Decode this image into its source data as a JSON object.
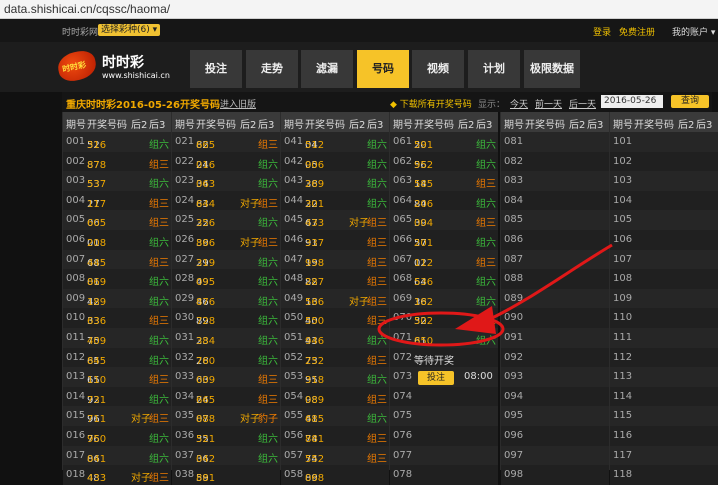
{
  "browser": {
    "url": "data.shishicai.cn/cqssc/haoma/"
  },
  "topbar": {
    "site": "时时彩网",
    "lottery_select": "选择彩种(6) ▾",
    "login": "登录",
    "register": "免费注册",
    "account": "我的账户 ▾"
  },
  "nav": {
    "logo_badge": "时时彩",
    "logo_cn": "时时彩",
    "logo_en": "www.shishicai.cn",
    "tabs": [
      "投注",
      "走势",
      "滤漏",
      "号码",
      "视频",
      "计划",
      "极限数据"
    ],
    "active_tab": "号码"
  },
  "datebar": {
    "title": "重庆时时彩2016-05-26开奖号码",
    "old_version": "进入旧版",
    "download": "◆ 下载所有开奖号码",
    "show_label": "显示：",
    "today": "今天",
    "prev_day": "前一天",
    "next_day": "后一天",
    "date_value": "2016-05-26",
    "query": "查询"
  },
  "table": {
    "headers": [
      "期号",
      "开奖号码",
      "后2",
      "后3"
    ],
    "columns": [
      [
        [
          "001",
          "52",
          "316",
          "",
          "组六"
        ],
        [
          "002",
          "87",
          "878",
          "",
          "组三"
        ],
        [
          "003",
          "53",
          "537",
          "",
          "组六"
        ],
        [
          "004",
          "27",
          "117",
          "",
          "组三"
        ],
        [
          "005",
          "06",
          "605",
          "",
          "组三"
        ],
        [
          "006",
          "01",
          "208",
          "",
          "组六"
        ],
        [
          "007",
          "68",
          "445",
          "",
          "组三"
        ],
        [
          "008",
          "01",
          "869",
          "",
          "组六"
        ],
        [
          "009",
          "42",
          "189",
          "",
          "组六"
        ],
        [
          "010",
          "33",
          "636",
          "",
          "组三"
        ],
        [
          "011",
          "75",
          "409",
          "",
          "组六"
        ],
        [
          "012",
          "65",
          "845",
          "",
          "组六"
        ],
        [
          "013",
          "65",
          "110",
          "",
          "组三"
        ],
        [
          "014",
          "92",
          "731",
          "",
          "组六"
        ],
        [
          "015",
          "96",
          "711",
          "对子",
          "组三"
        ],
        [
          "016",
          "76",
          "950",
          "",
          "组六"
        ],
        [
          "017",
          "86",
          "041",
          "",
          "组六"
        ],
        [
          "018",
          "48",
          "433",
          "对子",
          "组三"
        ]
      ],
      [
        [
          "021",
          "82",
          "665",
          "",
          "组三"
        ],
        [
          "022",
          "24",
          "016",
          "",
          "组六"
        ],
        [
          "023",
          "34",
          "063",
          "",
          "组六"
        ],
        [
          "024",
          "83",
          "644",
          "对子",
          "组三"
        ],
        [
          "025",
          "22",
          "356",
          "",
          "组六"
        ],
        [
          "026",
          "39",
          "866",
          "对子",
          "组三"
        ],
        [
          "027",
          "29",
          "319",
          "",
          "组六"
        ],
        [
          "028",
          "49",
          "095",
          "",
          "组六"
        ],
        [
          "029",
          "46",
          "876",
          "",
          "组六"
        ],
        [
          "030",
          "89",
          "728",
          "",
          "组六"
        ],
        [
          "031",
          "23",
          "384",
          "",
          "组六"
        ],
        [
          "032",
          "28",
          "760",
          "",
          "组六"
        ],
        [
          "033",
          "63",
          "009",
          "",
          "组三"
        ],
        [
          "034",
          "24",
          "665",
          "",
          "组三"
        ],
        [
          "035",
          "07",
          "888",
          "对子",
          "豹子"
        ],
        [
          "036",
          "35",
          "521",
          "",
          "组六"
        ],
        [
          "037",
          "36",
          "042",
          "",
          "组六"
        ],
        [
          "038",
          "59",
          "881",
          "",
          ""
        ]
      ],
      [
        [
          "041",
          "04",
          "512",
          "",
          "组六"
        ],
        [
          "042",
          "05",
          "906",
          "",
          "组六"
        ],
        [
          "043",
          "38",
          "269",
          "",
          "组六"
        ],
        [
          "044",
          "22",
          "301",
          "",
          "组六"
        ],
        [
          "045",
          "67",
          "433",
          "对子",
          "组三"
        ],
        [
          "046",
          "91",
          "337",
          "",
          "组三"
        ],
        [
          "047",
          "19",
          "958",
          "",
          "组三"
        ],
        [
          "048",
          "82",
          "287",
          "",
          "组三"
        ],
        [
          "049",
          "13",
          "566",
          "对子",
          "组三"
        ],
        [
          "050",
          "40",
          "550",
          "",
          "组三"
        ],
        [
          "051",
          "43",
          "946",
          "",
          "组六"
        ],
        [
          "052",
          "73",
          "252",
          "",
          "组三"
        ],
        [
          "053",
          "95",
          "318",
          "",
          "组六"
        ],
        [
          "054",
          "98",
          "089",
          "",
          "组三"
        ],
        [
          "055",
          "41",
          "685",
          "",
          "组六"
        ],
        [
          "056",
          "74",
          "881",
          "",
          "组三"
        ],
        [
          "057",
          "74",
          "552",
          "",
          "组三"
        ],
        [
          "058",
          "89",
          "068",
          "",
          ""
        ]
      ],
      [
        [
          "061",
          "20",
          "591",
          "",
          "组六"
        ],
        [
          "062",
          "56",
          "952",
          "",
          "组六"
        ],
        [
          "063",
          "14",
          "585",
          "",
          "组三"
        ],
        [
          "064",
          "84",
          "206",
          "",
          "组六"
        ],
        [
          "065",
          "39",
          "004",
          "",
          "组三"
        ],
        [
          "066",
          "57",
          "201",
          "",
          "组六"
        ],
        [
          "067",
          "02",
          "112",
          "",
          "组三"
        ],
        [
          "068",
          "64",
          "536",
          "",
          "组六"
        ],
        [
          "069",
          "36",
          "182",
          "",
          "组六"
        ],
        [
          "070",
          "32",
          "502",
          "",
          "组三"
        ],
        [
          "071",
          "61",
          "850",
          "",
          "组六"
        ]
      ],
      [
        "081",
        "082",
        "083",
        "084",
        "085",
        "086",
        "087",
        "088",
        "089",
        "090",
        "091",
        "092",
        "093",
        "094",
        "095",
        "096",
        "097",
        "098"
      ],
      [
        "101",
        "102",
        "103",
        "104",
        "105",
        "106",
        "107",
        "108",
        "109",
        "110",
        "111",
        "112",
        "113",
        "114",
        "115",
        "116",
        "117",
        "118"
      ]
    ],
    "pending": {
      "issue": "072",
      "status": "等待开奖",
      "bet_issue": "073",
      "bet_label": "投注",
      "bet_time": "08:00"
    },
    "tail_issues": [
      "074",
      "075",
      "076",
      "077",
      "078"
    ]
  }
}
